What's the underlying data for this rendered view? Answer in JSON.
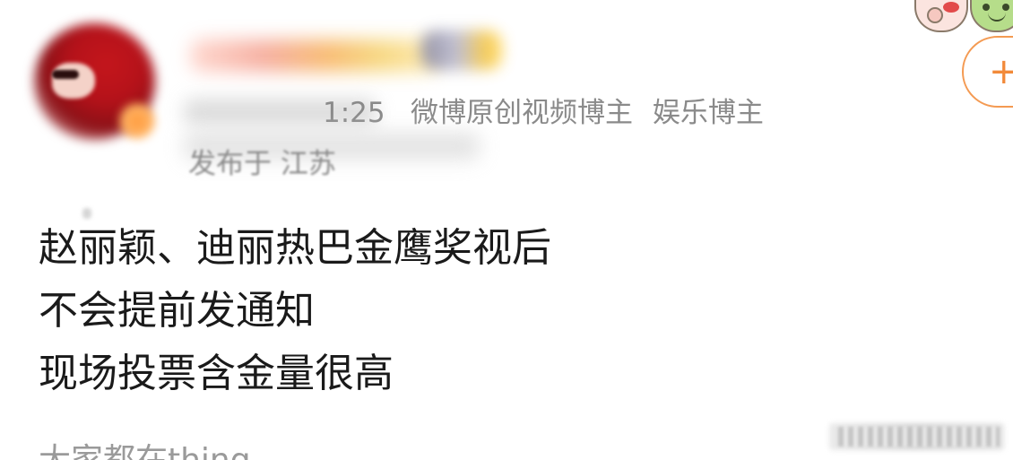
{
  "post": {
    "meta": {
      "time_suffix": "1:25",
      "tags": [
        "微博原创视频博主",
        "娱乐博主"
      ],
      "location": "发布于 江苏"
    },
    "body_lines": [
      "赵丽颖、迪丽热巴金鹰奖视后",
      "不会提前发通知",
      "现场投票含金量很高"
    ],
    "next_line_cropped": "大家都在thing"
  },
  "header": {
    "follow_symbol": "+"
  },
  "icons": {
    "sticker_left": "pig-face-sticker-icon",
    "sticker_right": "frog-face-sticker-icon",
    "follow": "plus-icon"
  },
  "colors": {
    "follow_accent": "#f28a3a",
    "meta_text": "#8a8a8a",
    "body_text": "#1a1a1a"
  }
}
